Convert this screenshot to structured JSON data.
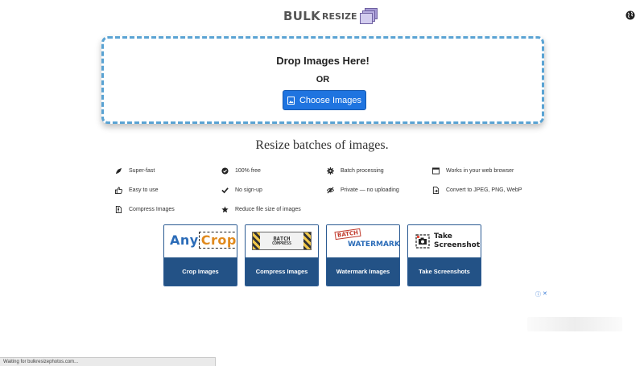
{
  "logo": {
    "bulk": "BULK",
    "resize": "RESIZE"
  },
  "dropzone": {
    "title": "Drop Images Here!",
    "or": "OR",
    "button_label": "Choose Images"
  },
  "tagline": "Resize batches of images.",
  "features": [
    {
      "label": "Super-fast",
      "icon": "rocket-icon"
    },
    {
      "label": "100% free",
      "icon": "check-circle-icon"
    },
    {
      "label": "Batch processing",
      "icon": "gear-icon"
    },
    {
      "label": "Works in your web browser",
      "icon": "browser-window-icon"
    },
    {
      "label": "Easy to use",
      "icon": "thumbs-up-icon"
    },
    {
      "label": "No sign-up",
      "icon": "check-icon"
    },
    {
      "label": "Private — no uploading",
      "icon": "eye-slash-icon"
    },
    {
      "label": "Convert to JPEG, PNG, WebP",
      "icon": "convert-file-icon"
    },
    {
      "label": "Compress Images",
      "icon": "compress-file-icon"
    },
    {
      "label": "Reduce file size of images",
      "icon": "star-icon"
    }
  ],
  "cards": [
    {
      "caption": "Crop Images",
      "thumb": {
        "a": "Any",
        "b": "Crop"
      }
    },
    {
      "caption": "Compress Images",
      "thumb": {
        "a": "BATCH",
        "b": "COMPRESS"
      }
    },
    {
      "caption": "Watermark Images",
      "thumb": {
        "a": "BATCH",
        "b": "WATERMARK"
      }
    },
    {
      "caption": "Take Screenshots",
      "thumb": {
        "a": "Take",
        "b": "Screenshot"
      }
    }
  ],
  "colors": {
    "accent": "#1f74e0",
    "card_caption_bg": "#235286",
    "dropzone_border": "#5aa3d3"
  },
  "status_bar": "Waiting for bulkresizephotos.com..."
}
